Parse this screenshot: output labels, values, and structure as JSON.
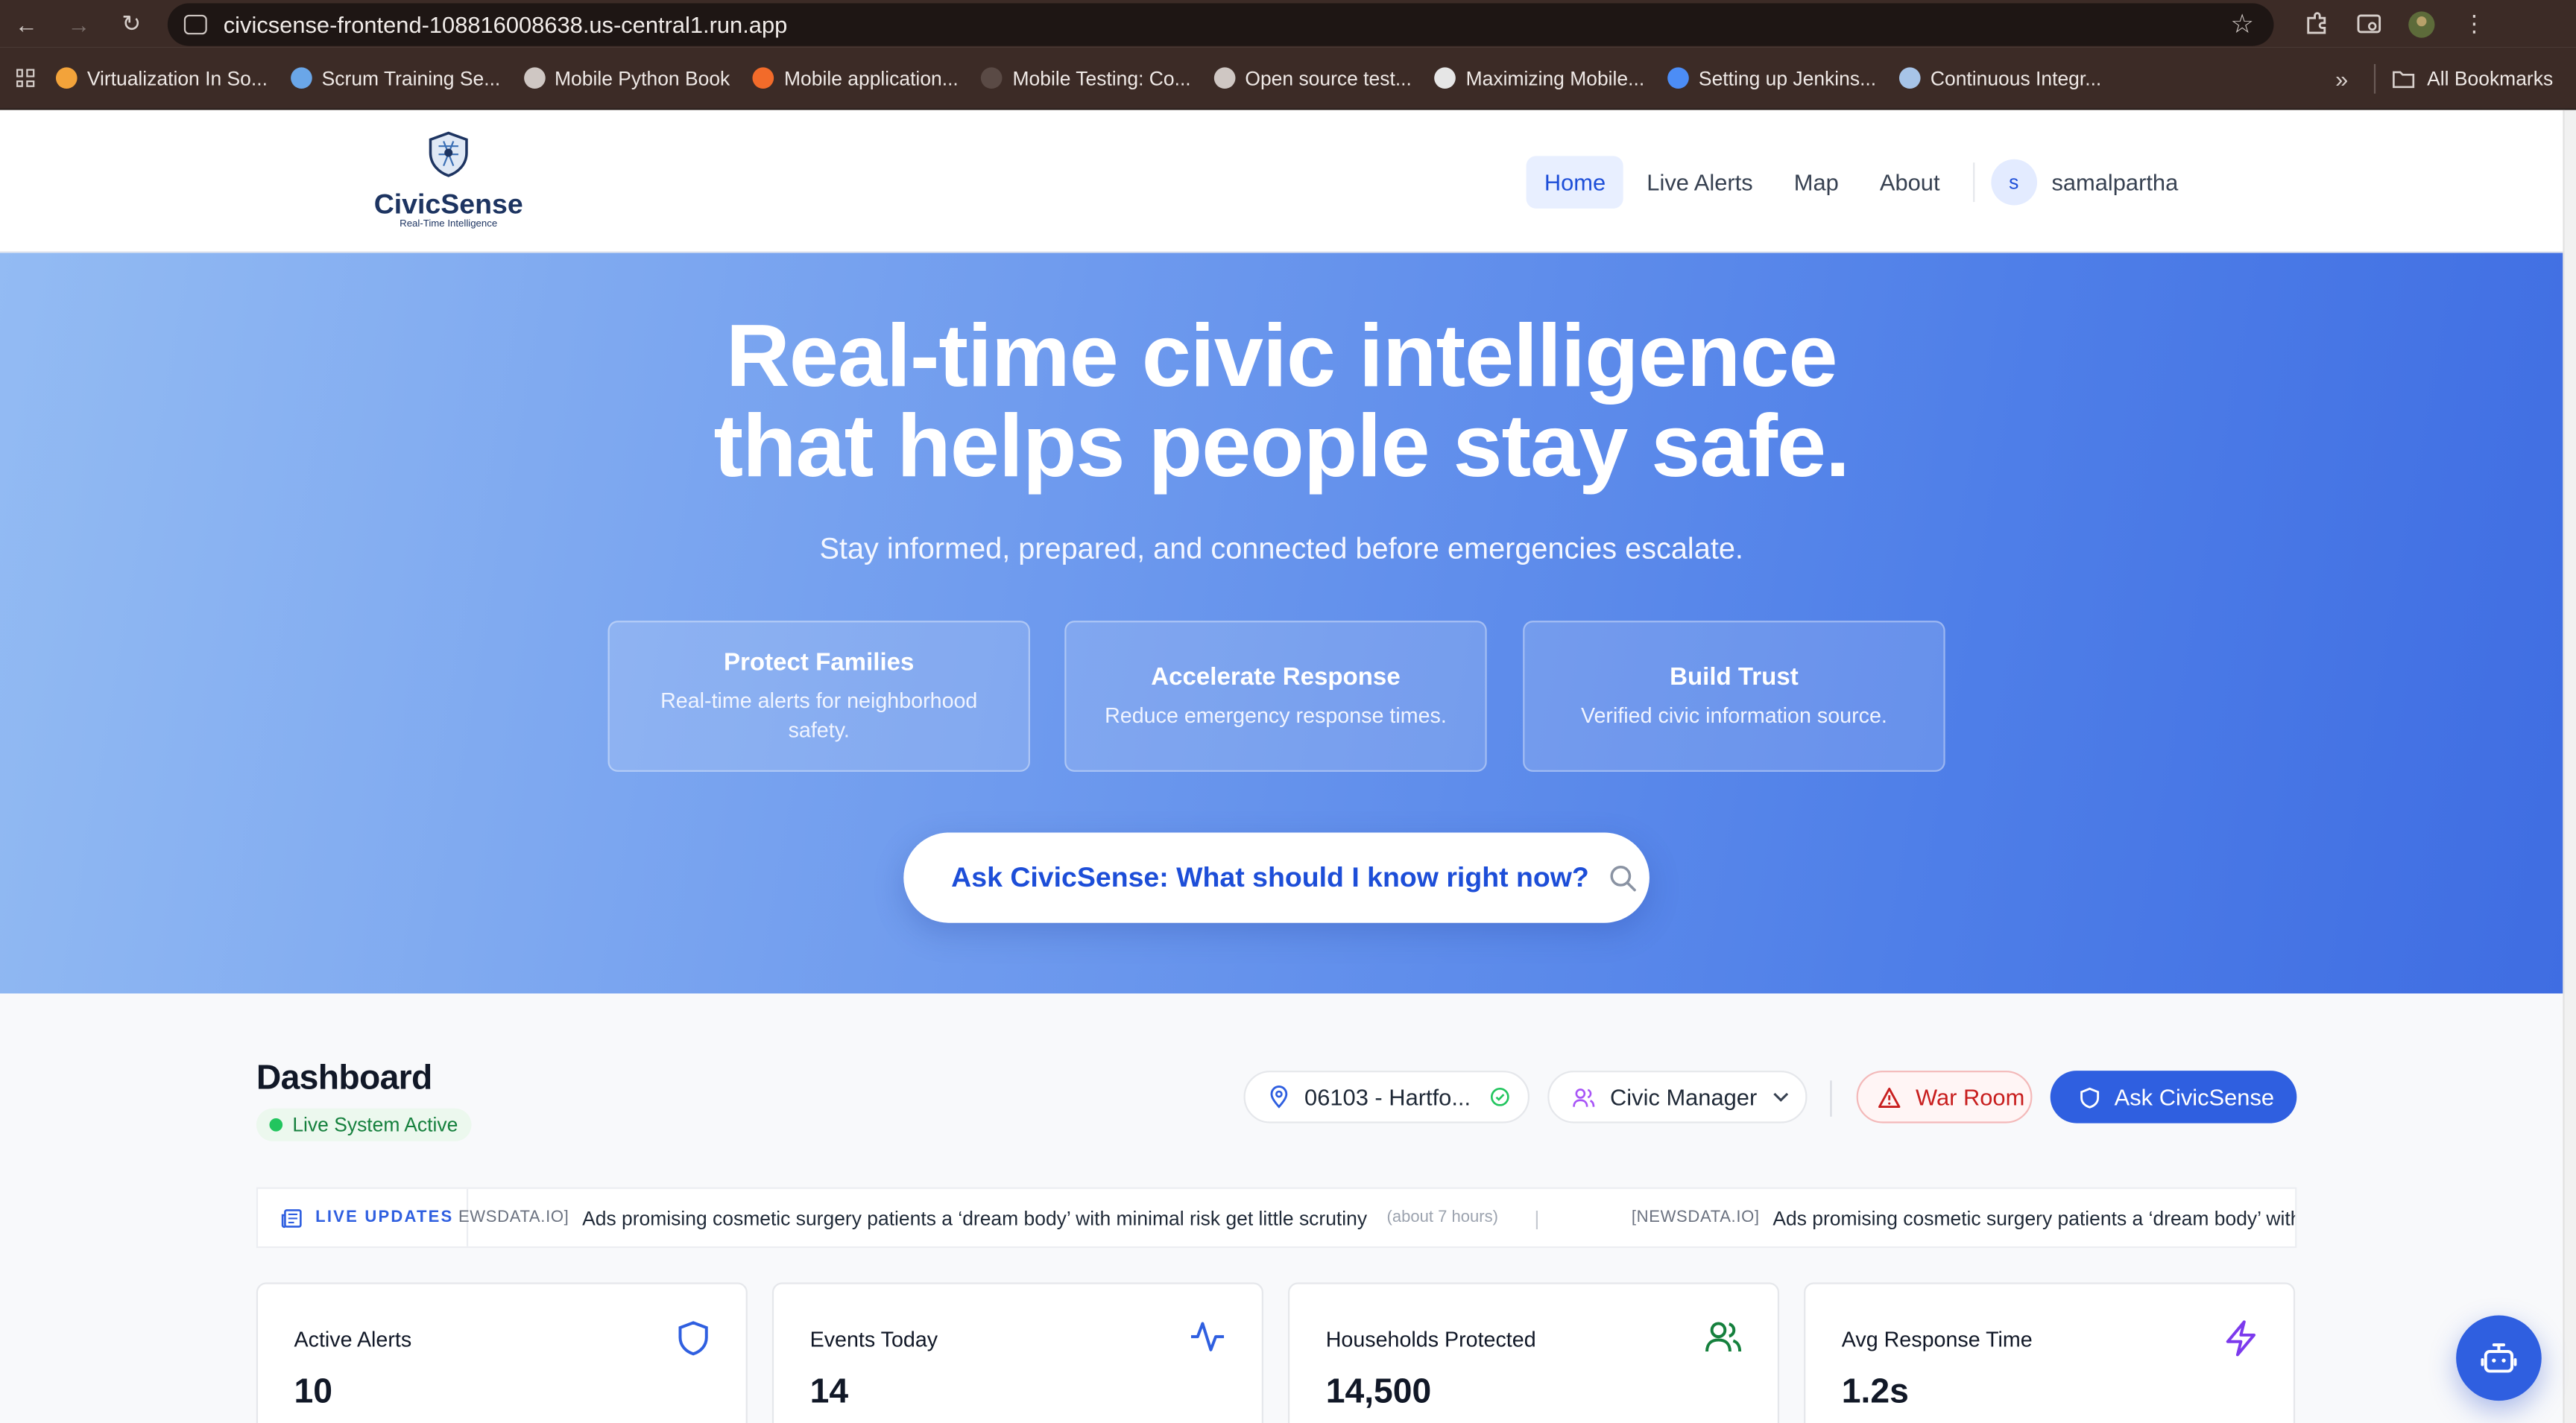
{
  "browser": {
    "url": "civicsense-frontend-108816008638.us-central1.run.app",
    "bookmarks": [
      {
        "label": "Virtualization In So...",
        "color": "#f3a33a"
      },
      {
        "label": "Scrum Training Se...",
        "color": "#6aa6e8"
      },
      {
        "label": "Mobile Python Book",
        "color": "#cfc7c3"
      },
      {
        "label": "Mobile application...",
        "color": "#f26b2a"
      },
      {
        "label": "Mobile Testing: Co...",
        "color": "#5a4a45"
      },
      {
        "label": "Open source test...",
        "color": "#cfc7c3"
      },
      {
        "label": "Maximizing Mobile...",
        "color": "#e6e6e6"
      },
      {
        "label": "Setting up Jenkins...",
        "color": "#4c8df6"
      },
      {
        "label": "Continuous Integr...",
        "color": "#a7c4e8"
      }
    ],
    "all_bookmarks": "All Bookmarks"
  },
  "header": {
    "brand": "CivicSense",
    "tagline": "Real-Time Intelligence",
    "nav": [
      "Home",
      "Live Alerts",
      "Map",
      "About"
    ],
    "avatar_initial": "s",
    "username": "samalpartha"
  },
  "hero": {
    "title_line1": "Real-time civic intelligence",
    "title_line2": "that helps people stay safe.",
    "subtitle": "Stay informed, prepared, and connected before emergencies escalate.",
    "features": [
      {
        "title": "Protect Families",
        "desc": "Real-time alerts for neighborhood safety."
      },
      {
        "title": "Accelerate Response",
        "desc": "Reduce emergency response times."
      },
      {
        "title": "Build Trust",
        "desc": "Verified civic information source."
      }
    ],
    "ask_prompt": "Ask CivicSense: What should I know right now?"
  },
  "dashboard": {
    "title": "Dashboard",
    "status": "Live System Active",
    "location": "06103 - Hartfo...",
    "role": "Civic Manager",
    "war_room": "War Room",
    "ask_button": "Ask CivicSense",
    "ticker": {
      "label": "LIVE UPDATES",
      "items": [
        {
          "source": "EWSDATA.IO]",
          "headline": "Ads promising cosmetic surgery patients a ‘dream body’ with minimal risk get little scrutiny",
          "age": "(about 7 hours)"
        },
        {
          "source": "[NEWSDATA.IO]",
          "headline": "Ads promising cosmetic surgery patients a ‘dream body’ with",
          "age": ""
        }
      ],
      "separator": "|"
    },
    "stats": [
      {
        "label": "Active Alerts",
        "value": "10",
        "icon": "shield-icon",
        "color": "#2f5fe0"
      },
      {
        "label": "Events Today",
        "value": "14",
        "icon": "activity-icon",
        "color": "#2f5fe0"
      },
      {
        "label": "Households Protected",
        "value": "14,500",
        "icon": "users-icon",
        "color": "#15803d"
      },
      {
        "label": "Avg Response Time",
        "value": "1.2s",
        "icon": "zap-icon",
        "color": "#7c3aed"
      }
    ]
  }
}
